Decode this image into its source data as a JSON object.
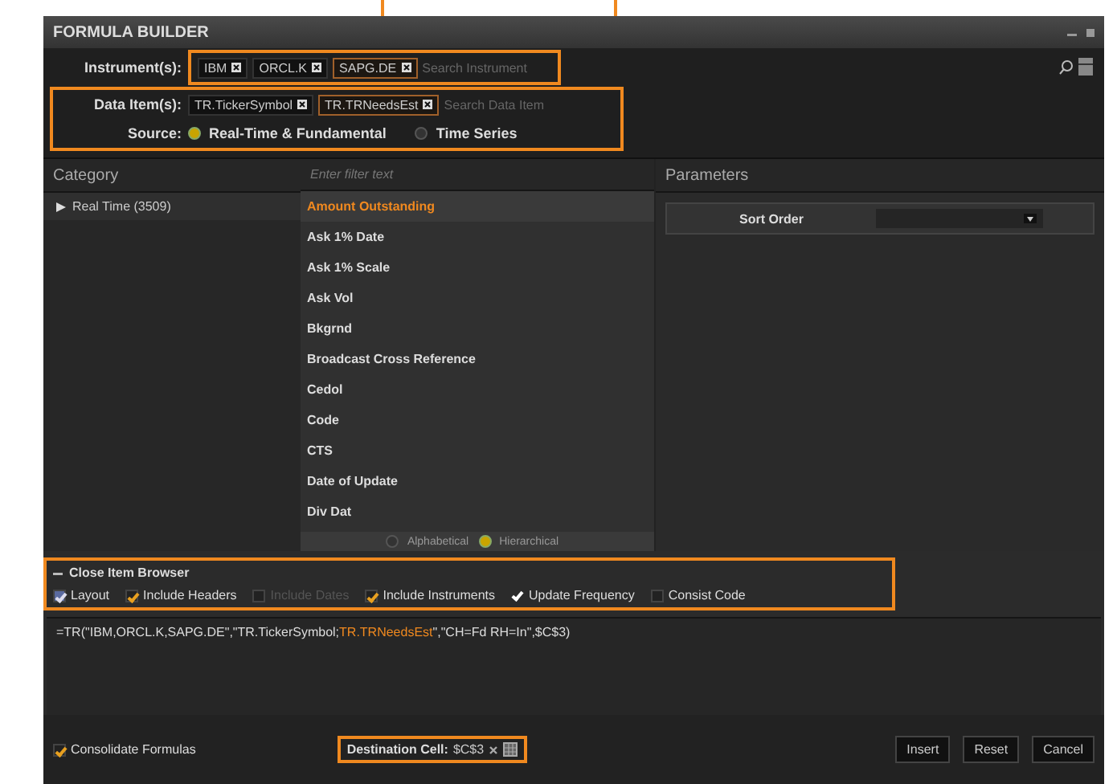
{
  "window": {
    "title": "FORMULA BUILDER"
  },
  "instruments": {
    "label": "Instrument(s):",
    "tags": [
      {
        "text": "IBM",
        "selected": false
      },
      {
        "text": "ORCL.K",
        "selected": false
      },
      {
        "text": "SAPG.DE",
        "selected": true
      }
    ],
    "placeholder": "Search Instrument"
  },
  "data_items": {
    "label": "Data Item(s):",
    "tags": [
      {
        "text": "TR.TickerSymbol",
        "selected": false
      },
      {
        "text": "TR.TRNeedsEst",
        "selected": true
      }
    ],
    "placeholder": "Search Data Item"
  },
  "source": {
    "label": "Source:",
    "options": [
      {
        "text": "Real-Time & Fundamental",
        "selected": true
      },
      {
        "text": "Time Series",
        "selected": false
      }
    ]
  },
  "category": {
    "header": "Category",
    "items": [
      {
        "text": "Real Time (3509)",
        "expanded": false
      }
    ]
  },
  "filter": {
    "placeholder": "Enter filter text"
  },
  "fields": {
    "items": [
      {
        "text": "Amount Outstanding",
        "selected": true
      },
      {
        "text": "Ask 1% Date",
        "selected": false
      },
      {
        "text": "Ask 1% Scale",
        "selected": false
      },
      {
        "text": "Ask Vol",
        "selected": false
      },
      {
        "text": "Bkgrnd",
        "selected": false
      },
      {
        "text": "Broadcast Cross Reference",
        "selected": false
      },
      {
        "text": "Cedol",
        "selected": false
      },
      {
        "text": "Code",
        "selected": false
      },
      {
        "text": "CTS",
        "selected": false
      },
      {
        "text": "Date of Update",
        "selected": false
      },
      {
        "text": "Div Dat",
        "selected": false
      }
    ],
    "sort": [
      {
        "text": "Alphabetical",
        "selected": false
      },
      {
        "text": "Hierarchical",
        "selected": true
      }
    ]
  },
  "parameters": {
    "header": "Parameters",
    "rows": [
      {
        "label": "Sort Order"
      }
    ]
  },
  "browser": {
    "toggle": "Close Item Browser",
    "options": [
      {
        "text": "Layout",
        "checked": true,
        "disabled": false,
        "kind": "layout"
      },
      {
        "text": "Include Headers",
        "checked": true,
        "disabled": false,
        "kind": "check"
      },
      {
        "text": "Include Dates",
        "checked": false,
        "disabled": true,
        "kind": "check"
      },
      {
        "text": "Include Instruments",
        "checked": true,
        "disabled": false,
        "kind": "check"
      },
      {
        "text": "Update Frequency",
        "checked": true,
        "disabled": false,
        "kind": "tick"
      },
      {
        "text": "Consist Code",
        "checked": false,
        "disabled": false,
        "kind": "check"
      }
    ]
  },
  "formula": {
    "text": "=TR(\"IBM,ORCL.K,SAPG.DE\",\"TR.TickerSymbol;",
    "highlight": "TR.TRNeedsEst",
    "rest": "\",\"CH=Fd RH=In\",$C$3)"
  },
  "footer": {
    "consolidate": {
      "text": "Consolidate Formulas",
      "checked": true
    },
    "destination": {
      "label": "Destination Cell:",
      "value": "$C$3"
    },
    "buttons": [
      "Insert",
      "Reset",
      "Cancel"
    ]
  }
}
